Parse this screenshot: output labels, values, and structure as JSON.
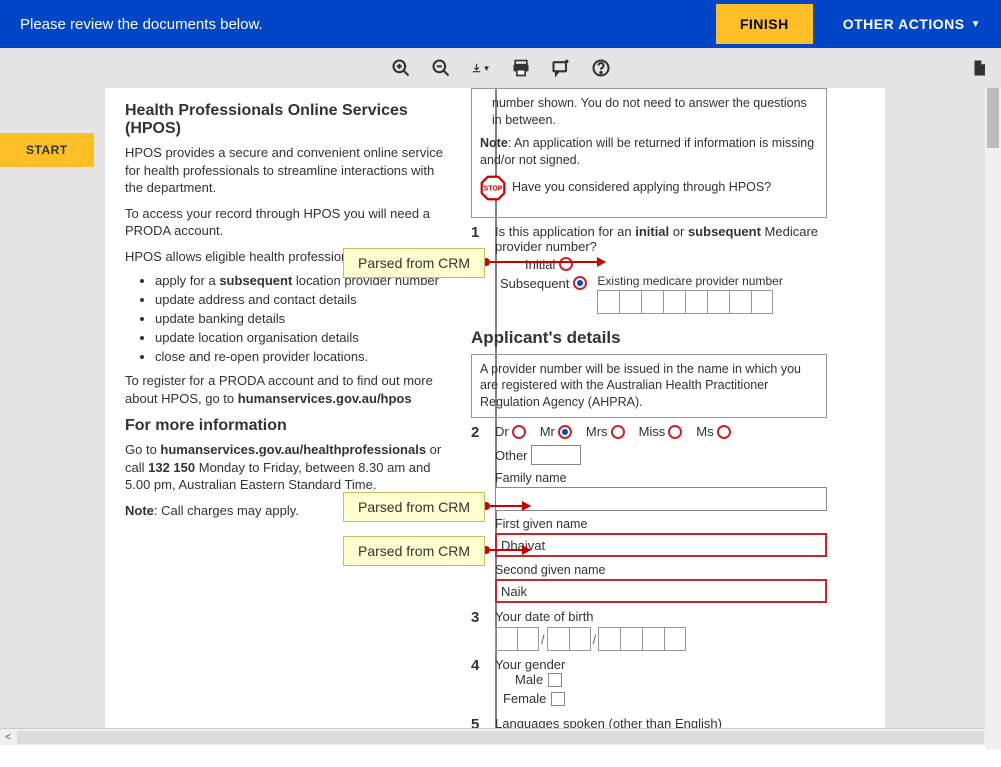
{
  "banner": {
    "message": "Please review the documents below.",
    "finish": "FINISH",
    "other_actions": "OTHER ACTIONS"
  },
  "sidebar": {
    "start": "START"
  },
  "left": {
    "title": "Health Professionals Online Services (HPOS)",
    "p1": "HPOS provides a secure and convenient online service for health professionals to streamline interactions with the department.",
    "p2": "To access your record through HPOS you will need a PRODA account.",
    "p3": "HPOS allows eligible health professionals to:",
    "bullets": {
      "b1a": "apply for a ",
      "b1b": "subsequent",
      "b1c": " location provider number",
      "b2": "update address and contact details",
      "b3": "update banking details",
      "b4": "update location organisation details",
      "b5": "close and re-open provider locations."
    },
    "p4a": "To register for a PRODA account and to find out more about HPOS, go to ",
    "p4b": "humanservices.gov.au/hpos",
    "more_info_hd": "For more information",
    "p5a": "Go to ",
    "p5b": "humanservices.gov.au/healthprofessionals",
    "p5c": " or call ",
    "p5d": "132 150",
    "p5e": " Monday to Friday, between 8.30 am and 5.00 pm, Australian Eastern Standard Time.",
    "p6a": "Note",
    "p6b": ": Call charges may apply."
  },
  "right": {
    "overflow": "number shown. You do not need to answer the questions in between.",
    "note_a": "Note",
    "note_b": ": An application will be returned if information is missing and/or not signed.",
    "stop_q": "Have you considered applying through HPOS?",
    "q1": {
      "text_a": "Is this application for an ",
      "text_b": "initial",
      "text_c": " or ",
      "text_d": "subsequent",
      "text_e": " Medicare provider number?",
      "initial": "Initial",
      "subsequent": "Subsequent",
      "existing": "Existing medicare provider number"
    },
    "applicant_hd": "Applicant's details",
    "applicant_note": "A provider number will be issued in the name in which you are registered with the Australian Health Practitioner Regulation Agency (AHPRA).",
    "q2": {
      "titles": {
        "dr": "Dr",
        "mr": "Mr",
        "mrs": "Mrs",
        "miss": "Miss",
        "ms": "Ms",
        "other": "Other"
      },
      "family_name": "Family name",
      "first_given": "First given name",
      "first_given_val": "Dhaivat",
      "second_given": "Second given name",
      "second_given_val": "Naik"
    },
    "q3": {
      "label": "Your date of birth"
    },
    "q4": {
      "label": "Your gender",
      "male": "Male",
      "female": "Female"
    },
    "q5": {
      "label": "Languages spoken (other than English)"
    }
  },
  "callouts": {
    "crm1": "Parsed from CRM",
    "crm2": "Parsed from CRM",
    "crm3": "Parsed from CRM"
  }
}
